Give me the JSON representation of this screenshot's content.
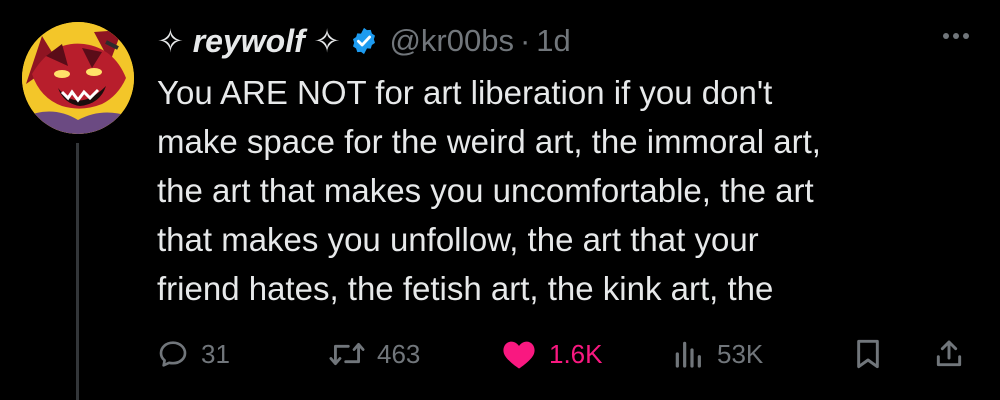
{
  "tweet": {
    "display_name": "✧ reywolf ✧",
    "handle": "@kr00bs",
    "separator": "·",
    "timestamp": "1d",
    "lines": [
      "You ARE NOT for art liberation if you don't",
      "make space for the weird art, the immoral art,",
      "the art that makes you uncomfortable, the art",
      "that makes you unfollow, the art that your",
      "friend hates, the fetish art, the kink art, the"
    ]
  },
  "actions": {
    "replies": "31",
    "retweets": "463",
    "likes": "1.6K",
    "views": "53K"
  },
  "colors": {
    "background": "#000000",
    "text": "#e7e9ea",
    "muted": "#71767b",
    "verified": "#1d9bf0",
    "like": "#f91880"
  },
  "icons": {
    "verified": "verified-badge-icon",
    "more": "more-dots-icon",
    "reply": "reply-icon",
    "retweet": "retweet-icon",
    "like": "heart-icon",
    "views": "views-bar-chart-icon",
    "bookmark": "bookmark-icon",
    "share": "share-icon"
  }
}
